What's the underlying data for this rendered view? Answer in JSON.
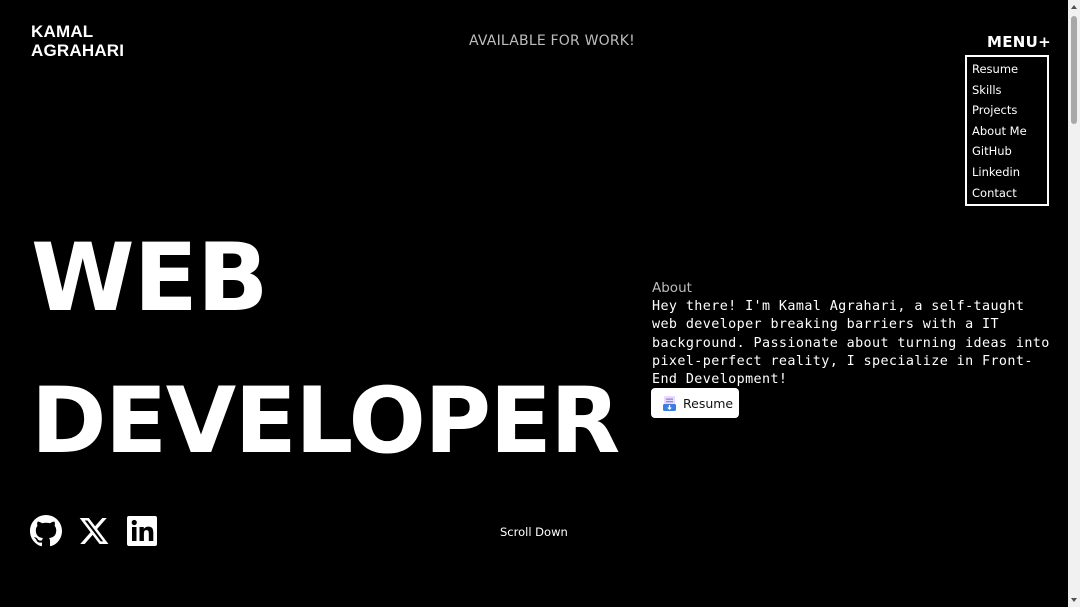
{
  "header": {
    "logo_line1": "KAMAL",
    "logo_line2": "AGRAHARI",
    "availability": "AVAILABLE FOR WORK!",
    "menu_label": "MENU+"
  },
  "menu": {
    "items": [
      "Resume",
      "Skills",
      "Projects",
      "About Me",
      "GitHub",
      "Linkedin",
      "Contact"
    ]
  },
  "hero": {
    "line1": "WEB",
    "line2": "DEVELOPER"
  },
  "about": {
    "heading": "About",
    "text": "Hey there! I'm Kamal Agrahari, a self-taught web developer breaking barriers with a IT background. Passionate about turning ideas into pixel-perfect reality, I specialize in Front-End Development!",
    "resume_button": "Resume"
  },
  "socials": {
    "icons": [
      "github-icon",
      "x-twitter-icon",
      "linkedin-icon"
    ]
  },
  "scroll_hint": "Scroll Down",
  "colors": {
    "background": "#000000",
    "text": "#ffffff",
    "muted": "#bdbdbd"
  }
}
